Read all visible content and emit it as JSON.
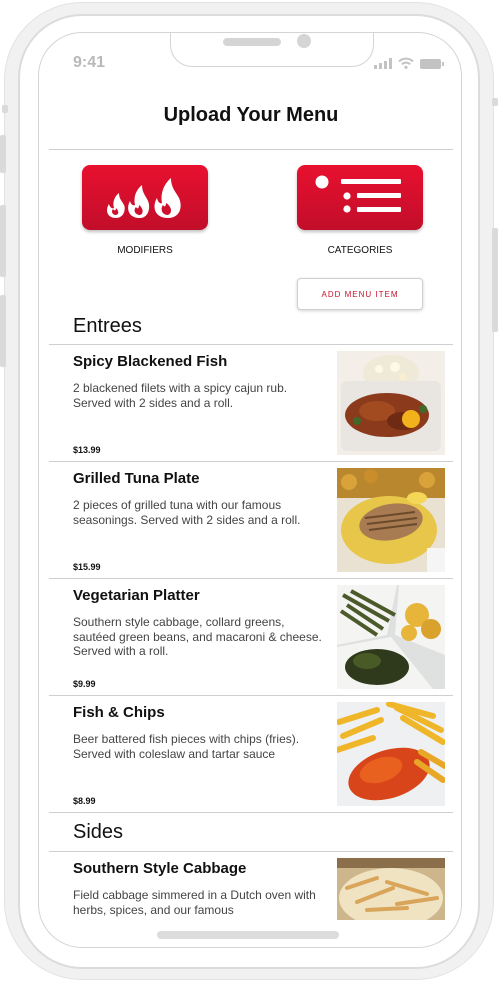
{
  "status_bar": {
    "time": "9:41"
  },
  "header": {
    "title": "Upload Your Menu"
  },
  "actions": {
    "modifiers_label": "MODIFIERS",
    "categories_label": "CATEGORIES",
    "add_item_label": "ADD MENU ITEM",
    "accent": "#d0102d"
  },
  "sections": [
    {
      "title": "Entrees",
      "items": [
        {
          "name": "Spicy Blackened Fish",
          "description": "2 blackened filets with a spicy cajun rub. Served with 2 sides and a roll.",
          "price": "$13.99"
        },
        {
          "name": "Grilled Tuna Plate",
          "description": "2 pieces of grilled tuna with our famous seasonings. Served with 2 sides and a roll.",
          "price": "$15.99"
        },
        {
          "name": "Vegetarian Platter",
          "description": "Southern style cabbage, collard greens, sautéed green beans, and macaroni & cheese. Served with a roll.",
          "price": "$9.99"
        },
        {
          "name": "Fish & Chips",
          "description": "Beer battered fish pieces with chips (fries). Served with coleslaw and tartar sauce",
          "price": "$8.99"
        }
      ]
    },
    {
      "title": "Sides",
      "items": [
        {
          "name": "Southern Style Cabbage",
          "description": "Field cabbage simmered in a Dutch oven with herbs, spices, and our famous"
        }
      ]
    }
  ]
}
